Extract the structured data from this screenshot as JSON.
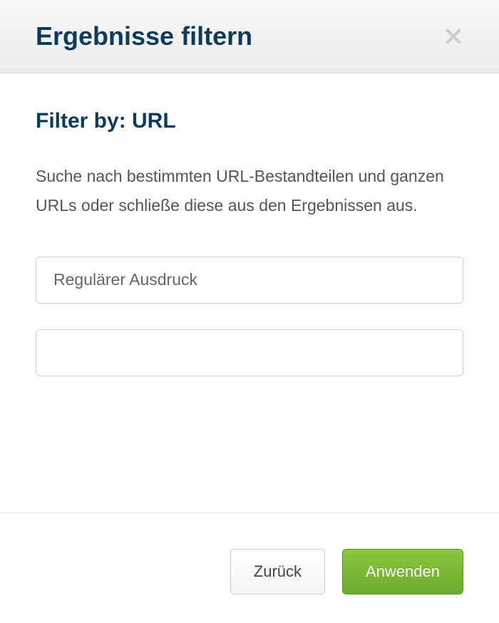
{
  "header": {
    "title": "Ergebnisse filtern"
  },
  "body": {
    "section_title": "Filter by: URL",
    "description": "Suche nach bestimmten URL-Bestandteilen und ganzen URLs oder schließe diese aus den Ergebnissen aus.",
    "input1_placeholder": "Regulärer Ausdruck",
    "input1_value": "",
    "input2_placeholder": "",
    "input2_value": ""
  },
  "footer": {
    "back_label": "Zurück",
    "apply_label": "Anwenden"
  }
}
